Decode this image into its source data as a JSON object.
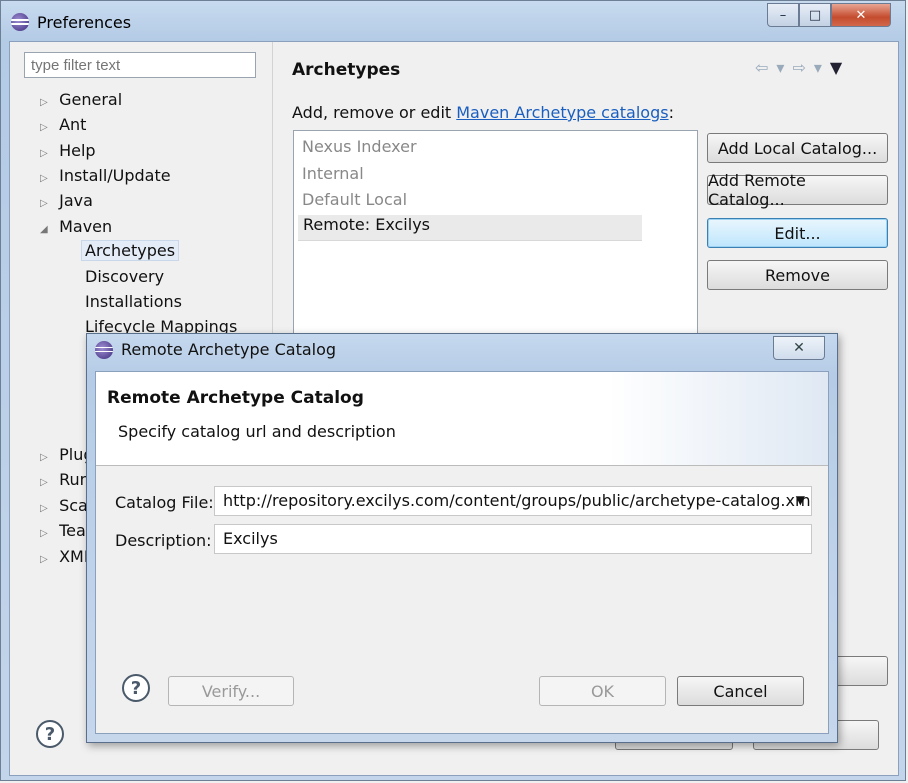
{
  "window": {
    "title": "Preferences",
    "minimize": "–",
    "maximize": "□",
    "close": "✕"
  },
  "filter": {
    "placeholder": "type filter text"
  },
  "tree": [
    {
      "label": "General",
      "arrow": "▷"
    },
    {
      "label": "Ant",
      "arrow": "▷"
    },
    {
      "label": "Help",
      "arrow": "▷"
    },
    {
      "label": "Install/Update",
      "arrow": "▷"
    },
    {
      "label": "Java",
      "arrow": "▷"
    },
    {
      "label": "Maven",
      "arrow": "◢"
    }
  ],
  "maven_children": [
    "Archetypes",
    "Discovery",
    "Installations",
    "Lifecycle Mappings"
  ],
  "tree_lower": [
    {
      "label": "Plug",
      "arrow": "▷"
    },
    {
      "label": "Run",
      "arrow": "▷"
    },
    {
      "label": "Scal",
      "arrow": "▷"
    },
    {
      "label": "Tea",
      "arrow": "▷"
    },
    {
      "label": "XML",
      "arrow": "▷"
    }
  ],
  "page": {
    "title": "Archetypes",
    "desc_prefix": "Add, remove or edit ",
    "desc_link": "Maven Archetype catalogs",
    "desc_suffix": ":",
    "catalogs": [
      "Nexus Indexer",
      "Internal",
      "Default Local",
      "Remote: Excilys"
    ],
    "buttons": {
      "add_local": "Add Local Catalog...",
      "add_remote": "Add Remote Catalog...",
      "edit": "Edit...",
      "remove": "Remove"
    }
  },
  "help": "?",
  "dialog": {
    "title": "Remote Archetype Catalog",
    "heading": "Remote Archetype Catalog",
    "message": "Specify catalog url and description",
    "catalog_file_label": "Catalog File:",
    "catalog_file_value": "http://repository.excilys.com/content/groups/public/archetype-catalog.xml",
    "description_label": "Description:",
    "description_value": "Excilys",
    "verify": "Verify...",
    "ok": "OK",
    "cancel": "Cancel",
    "close": "✕"
  },
  "colors": {
    "accent": "#3c7fb1",
    "link": "#1a5fc0"
  }
}
